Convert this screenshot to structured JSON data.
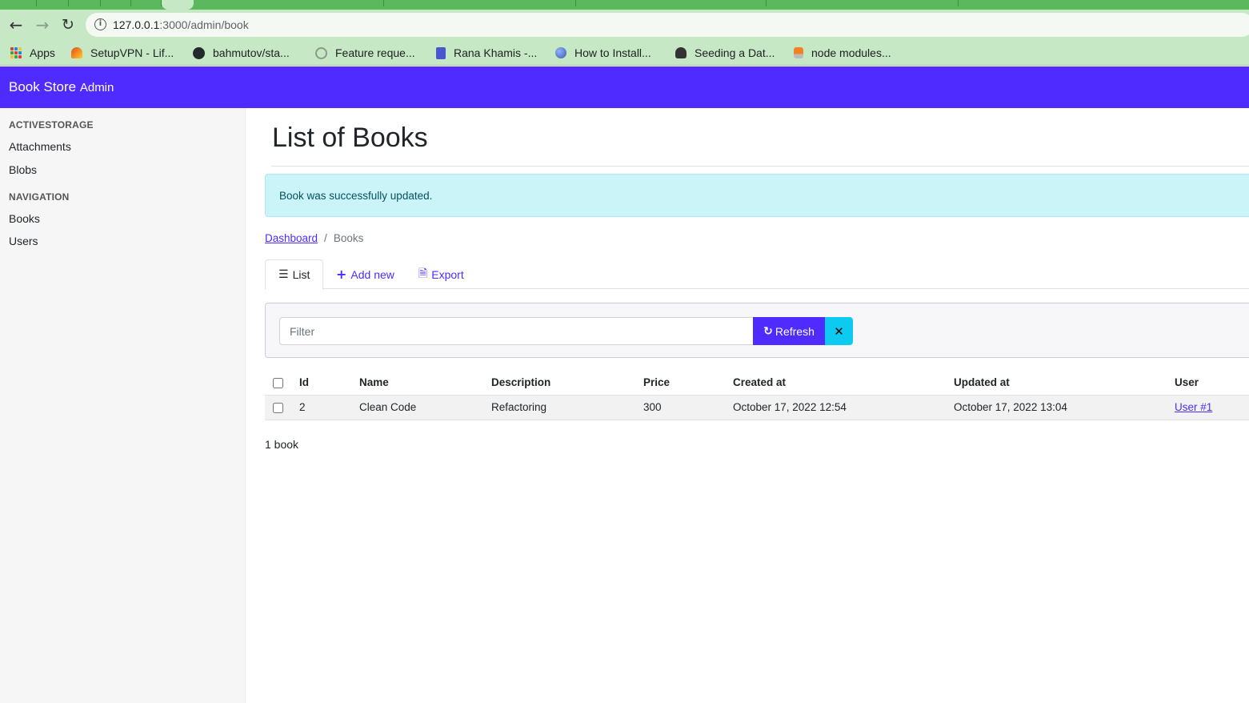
{
  "browser": {
    "url_host": "127.0.0.1",
    "url_path": ":3000/admin/book",
    "bookmarks": [
      {
        "label": "Apps",
        "icon": "apps-grid-icon",
        "color": "#e53935"
      },
      {
        "label": "SetupVPN - Lif...",
        "icon": "vpn-icon",
        "color": "#e64a19"
      },
      {
        "label": "bahmutov/sta...",
        "icon": "github-icon",
        "color": "#24292e"
      },
      {
        "label": "Feature reque...",
        "icon": "github-icon",
        "color": "#8a9a88"
      },
      {
        "label": "Rana Khamis -...",
        "icon": "docs-icon",
        "color": "#4a56d1"
      },
      {
        "label": "How to Install...",
        "icon": "globe-icon",
        "color": "#3b5ba9"
      },
      {
        "label": "Seeding a Dat...",
        "icon": "person-icon",
        "color": "#333333"
      },
      {
        "label": "node modules...",
        "icon": "stackoverflow-icon",
        "color": "#f48024"
      }
    ]
  },
  "header": {
    "brand": "Book Store",
    "brand_sub": "Admin",
    "color": "#4f2bff"
  },
  "sidebar": {
    "sections": [
      {
        "heading": "ACTIVESTORAGE",
        "items": [
          "Attachments",
          "Blobs"
        ]
      },
      {
        "heading": "NAVIGATION",
        "items": [
          "Books",
          "Users"
        ]
      }
    ]
  },
  "main": {
    "title": "List of Books",
    "alert": "Book was successfully updated.",
    "breadcrumb": {
      "home": "Dashboard",
      "sep": "/",
      "current": "Books"
    },
    "tabs": [
      {
        "label": "List",
        "icon": "list-icon"
      },
      {
        "label": "Add new",
        "icon": "plus-icon"
      },
      {
        "label": "Export",
        "icon": "export-icon"
      }
    ],
    "filter": {
      "placeholder": "Filter",
      "refresh_label": "Refresh",
      "clear_icon": "close-icon"
    },
    "table": {
      "columns": [
        "Id",
        "Name",
        "Description",
        "Price",
        "Created at",
        "Updated at",
        "User"
      ],
      "rows": [
        {
          "id": "2",
          "name": "Clean Code",
          "description": "Refactoring",
          "price": "300",
          "created_at": "October 17, 2022 12:54",
          "updated_at": "October 17, 2022 13:04",
          "user": "User #1"
        }
      ]
    },
    "count": "1 book"
  }
}
